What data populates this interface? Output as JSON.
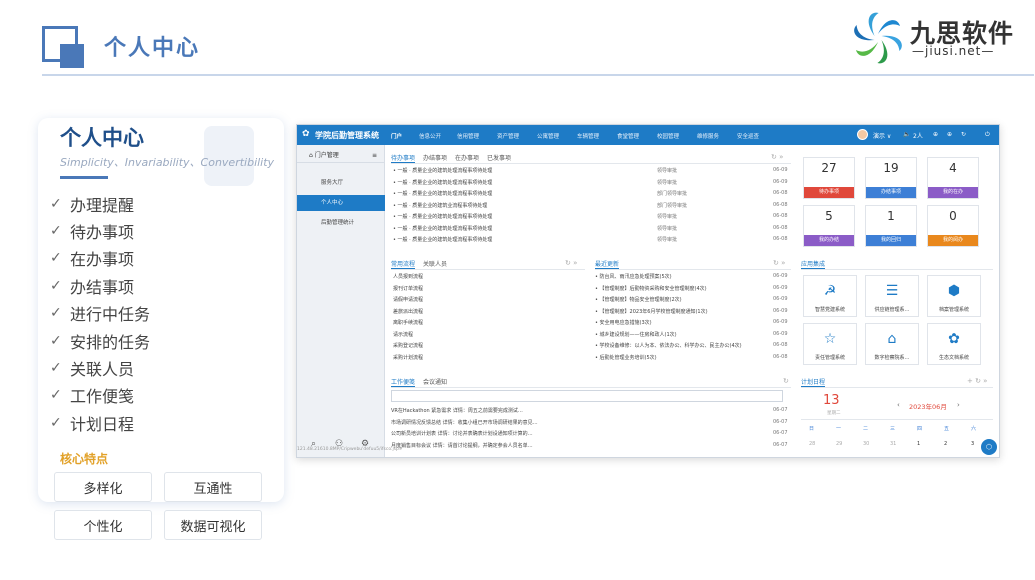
{
  "header": {
    "title": "个人中心",
    "logo_name": "九思软件",
    "logo_url": "—jiusi.net—"
  },
  "card": {
    "title": "个人中心",
    "subtitle": "Simplicity、Invariability、Convertibility",
    "features": [
      "办理提醒",
      "待办事项",
      "在办事项",
      "办结事项",
      "进行中任务",
      "安排的任务",
      "关联人员",
      "工作便笺",
      "计划日程"
    ],
    "core_label": "核心特点",
    "chips": [
      "多样化",
      "互通性",
      "个性化",
      "数据可视化"
    ]
  },
  "app": {
    "brand": "学院后勤管理系统",
    "nav": [
      "门户",
      "信息公开",
      "信用管理",
      "资产管理",
      "公寓管理",
      "车辆管理",
      "食堂管理",
      "校园管理",
      "维修服务",
      "安全巡查"
    ],
    "user": "演示 ∨",
    "users_count": "2人",
    "sidebar_head": "门户管理",
    "sidebar_items": [
      "服务大厅",
      "个人中心",
      "后勤管理统计"
    ],
    "footer_url": "121.48.21610.8MP/Cripwebu'defuu5/ifsco.jsp#",
    "todo": {
      "tabs": [
        "待办事项",
        "办结事项",
        "在办事项",
        "已发事项"
      ],
      "rows": [
        {
          "t": "• 一般 · 质量企业的建筑处理流程事项待处理",
          "s": "领导审批",
          "d": "06-09"
        },
        {
          "t": "• 一般 · 质量企业的建筑处理流程事项待处理",
          "s": "领导审批",
          "d": "06-09"
        },
        {
          "t": "• 一般 · 质量企业的建筑处理流程事项待处理",
          "s": "部门领导审批",
          "d": "06-08"
        },
        {
          "t": "• 一般 · 质量企业的建筑业流程事项待处理",
          "s": "部门领导审批",
          "d": "06-08"
        },
        {
          "t": "• 一般 · 质量企业的建筑处理流程事项待处理",
          "s": "领导审批",
          "d": "06-08"
        },
        {
          "t": "• 一般 · 质量企业的建筑处理流程事项待处理",
          "s": "领导审批",
          "d": "06-08"
        },
        {
          "t": "• 一般 · 质量企业的建筑处理流程事项待处理",
          "s": "领导审批",
          "d": "06-08"
        }
      ]
    },
    "stats": [
      {
        "n": "27",
        "label": "待办事项",
        "color": "#e0483b"
      },
      {
        "n": "19",
        "label": "办结事项",
        "color": "#3d7fd6"
      },
      {
        "n": "4",
        "label": "我的在办",
        "color": "#8b5cc7"
      },
      {
        "n": "5",
        "label": "我的办结",
        "color": "#8b5cc7"
      },
      {
        "n": "1",
        "label": "我的回归",
        "color": "#3d7fd6"
      },
      {
        "n": "0",
        "label": "我的阅办",
        "color": "#e9881d"
      }
    ],
    "flow": {
      "tabs": [
        "常用流程",
        "关联人员"
      ],
      "rows": [
        "人员报到流程",
        "报刊订单流程",
        "请假申请流程",
        "差旅派出流程",
        "离职手续流程",
        "请示流程",
        "采购登记流程",
        "采购计划流程"
      ]
    },
    "news": {
      "title": "最近更新",
      "rows": [
        {
          "t": "• 防台风、雨汛应急处理预案(5次)",
          "d": "06-09"
        },
        {
          "t": "• 【管理制度】后勤物资采购和安全管理制度(4次)",
          "d": "06-09"
        },
        {
          "t": "• 【管理制度】物品安全管理制度(2次)",
          "d": "06-09"
        },
        {
          "t": "• 【管理制度】2023年6月学校管理制度通知(1次)",
          "d": "06-09"
        },
        {
          "t": "• 安全用电应急措施(3次)",
          "d": "06-09"
        },
        {
          "t": "• 城乡建设规划——住房和政人(1次)",
          "d": "06-09"
        },
        {
          "t": "• 学校设备维修：以人为本、依法办公、科学办公、民主办公(4次)",
          "d": "06-08"
        },
        {
          "t": "• 后勤处管理业务培训(5次)",
          "d": "06-08"
        }
      ]
    },
    "apps_title": "应用集成",
    "apps": [
      {
        "icon": "☭",
        "label": "智慧党建系统"
      },
      {
        "icon": "☰",
        "label": "供应链管理系…"
      },
      {
        "icon": "⬢",
        "label": "档案管理系统"
      },
      {
        "icon": "☆",
        "label": "责任管理系统"
      },
      {
        "icon": "⌂",
        "label": "数字检察院系…"
      },
      {
        "icon": "✿",
        "label": "生态文档系统"
      }
    ],
    "notes": {
      "tabs": [
        "工作便笺",
        "会议通知"
      ],
      "rows": [
        {
          "t": "VR在Hackathon 紧急需求 详情：周五之前需要完成测试…",
          "d": "06-07"
        },
        {
          "t": "市场调研情况反馈总结 详情：收集小组已开市场调研结果的意见…",
          "d": "06-07"
        },
        {
          "t": "公司新员培训计划表 详情：讨论并表确表计划设通知项计算的…",
          "d": "06-07"
        },
        {
          "t": "月度销售目标会议 详情：请首讨论提纲，并确定参会人员名单…",
          "d": "06-07"
        }
      ]
    },
    "calendar": {
      "title": "计划日程",
      "day": "13",
      "weekday": "星期二",
      "month": "2023年06月",
      "weekdays": [
        "日",
        "一",
        "二",
        "三",
        "四",
        "五",
        "六"
      ],
      "days": [
        "28",
        "29",
        "30",
        "31",
        "1",
        "2",
        "3"
      ]
    }
  }
}
